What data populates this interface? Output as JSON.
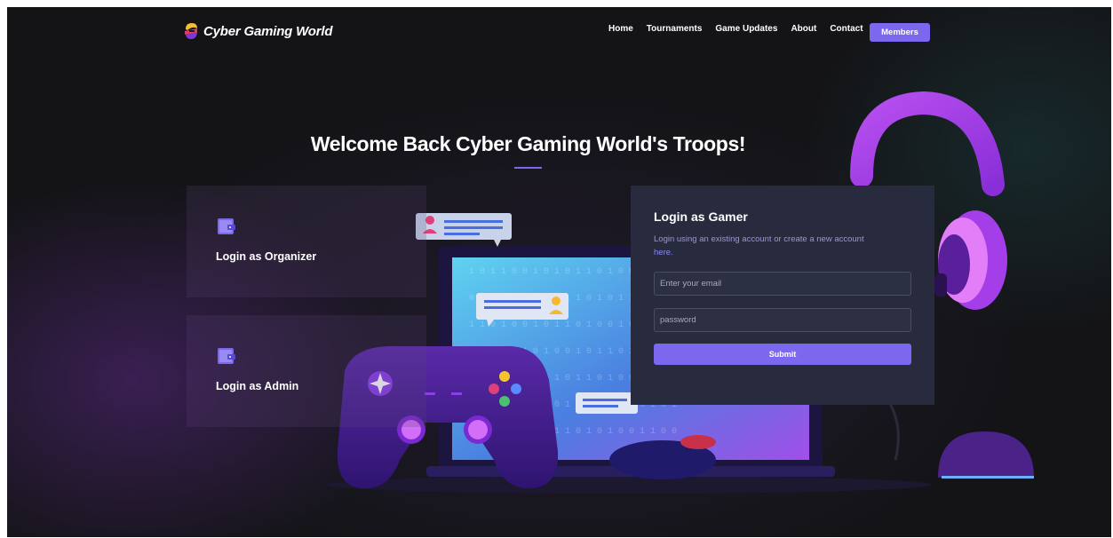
{
  "brand": {
    "name": "Cyber Gaming World"
  },
  "nav": {
    "items": [
      "Home",
      "Tournaments",
      "Game Updates",
      "About",
      "Contact"
    ],
    "members_label": "Members"
  },
  "hero": {
    "title": "Welcome Back Cyber Gaming World's Troops!"
  },
  "cards": [
    {
      "label": "Login as Organizer",
      "icon": "wallet-icon"
    },
    {
      "label": "Login as Admin",
      "icon": "wallet-icon"
    }
  ],
  "login": {
    "title": "Login as Gamer",
    "description": "Login using an existing account or create a new account",
    "link_text": "here.",
    "email_placeholder": "Enter your email",
    "password_placeholder": "password",
    "submit_label": "Submit"
  },
  "colors": {
    "accent": "#7b68ee",
    "panel": "#272b3d",
    "background": "#141417"
  }
}
